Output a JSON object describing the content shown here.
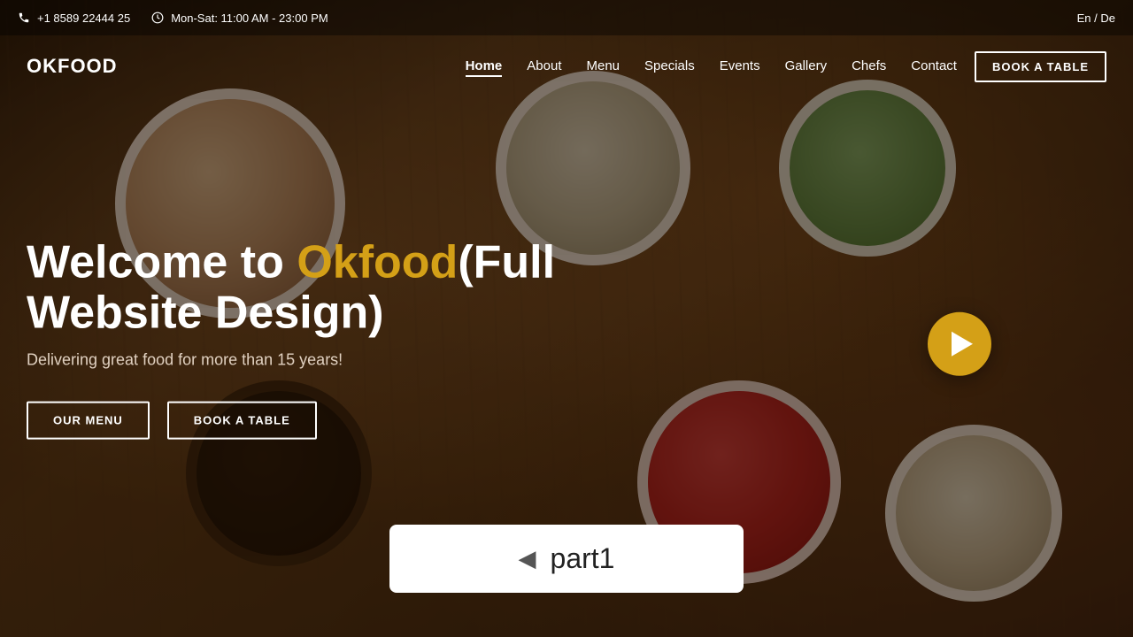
{
  "topbar": {
    "phone": "+1 8589 22444 25",
    "hours": "Mon-Sat: 11:00 AM - 23:00 PM",
    "lang": "En  /  De"
  },
  "navbar": {
    "logo": "OKFOOD",
    "links": [
      {
        "label": "Home",
        "active": true
      },
      {
        "label": "About",
        "active": false
      },
      {
        "label": "Menu",
        "active": false
      },
      {
        "label": "Specials",
        "active": false
      },
      {
        "label": "Events",
        "active": false
      },
      {
        "label": "Gallery",
        "active": false
      },
      {
        "label": "Chefs",
        "active": false
      },
      {
        "label": "Contact",
        "active": false
      }
    ],
    "book_label": "BOOK A TABLE"
  },
  "hero": {
    "title_prefix": "Welcome to ",
    "title_brand": "Okfood",
    "title_suffix": "(Full Website Design)",
    "subtitle": "Delivering great food for more than 15 years!",
    "btn_menu": "OUR MENU",
    "btn_book": "BOOK A TABLE"
  },
  "annotation": {
    "arrow": "◀",
    "label": "part1"
  }
}
